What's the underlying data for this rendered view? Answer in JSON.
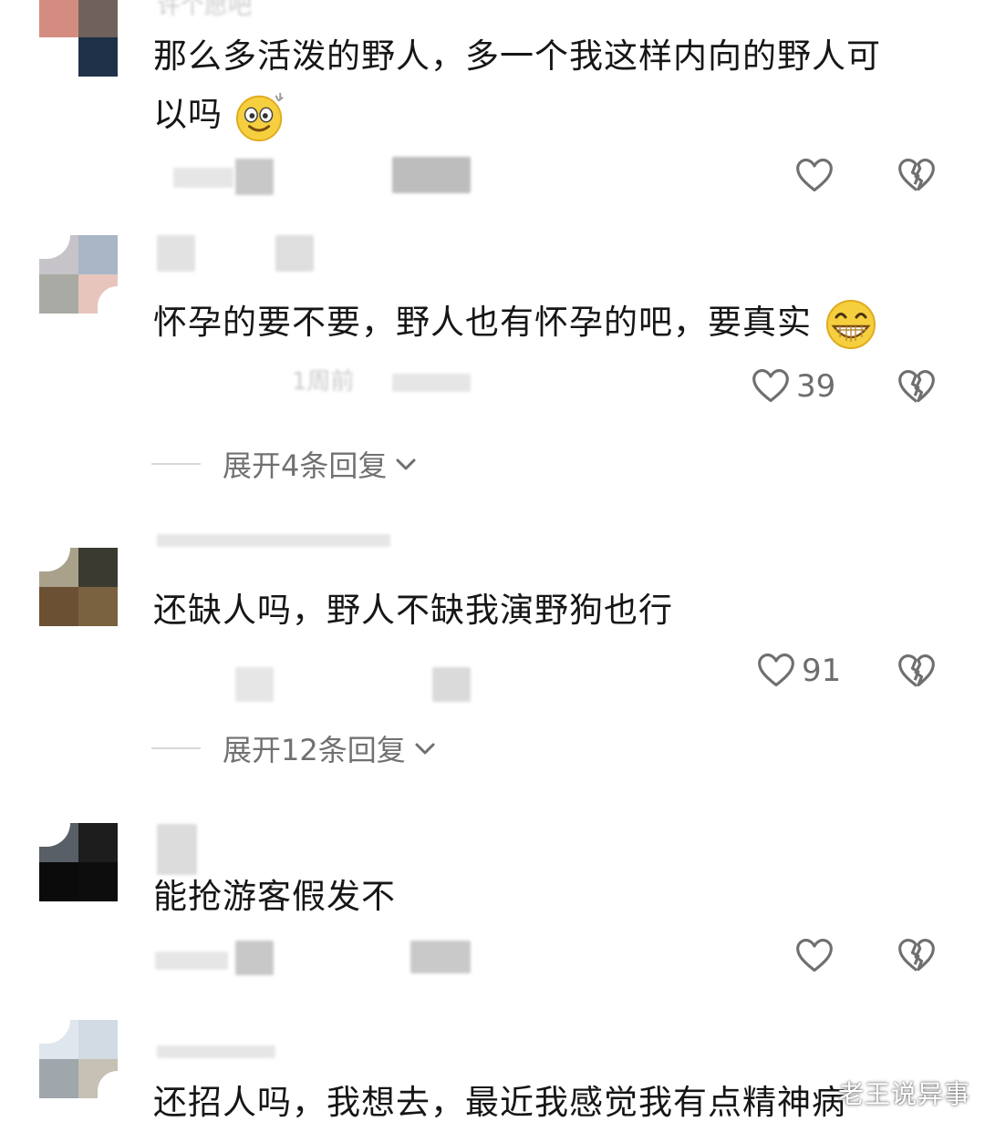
{
  "comments": [
    {
      "text_lines": [
        "那么多活泼的野人，多一个我这样内向的野人可",
        "以吗"
      ],
      "emoji": "dizzy-smile-emoji",
      "like_count": "",
      "expand_label": ""
    },
    {
      "text_lines": [
        "怀孕的要不要，野人也有怀孕的吧，要真实"
      ],
      "emoji": "grin-emoji",
      "like_count": "39",
      "expand_label": "展开4条回复"
    },
    {
      "text_lines": [
        "还缺人吗，野人不缺我演野狗也行"
      ],
      "emoji": "",
      "like_count": "91",
      "expand_label": "展开12条回复"
    },
    {
      "text_lines": [
        "能抢游客假发不"
      ],
      "emoji": "",
      "like_count": "",
      "expand_label": ""
    },
    {
      "text_lines": [
        "还招人吗，我想去，最近我感觉我有点精神病"
      ],
      "emoji": "",
      "like_count": "",
      "expand_label": ""
    }
  ],
  "watermark": "老王说异事",
  "colors": {
    "text": "#161616",
    "meta": "#6d6d6d",
    "background": "#ffffff"
  }
}
